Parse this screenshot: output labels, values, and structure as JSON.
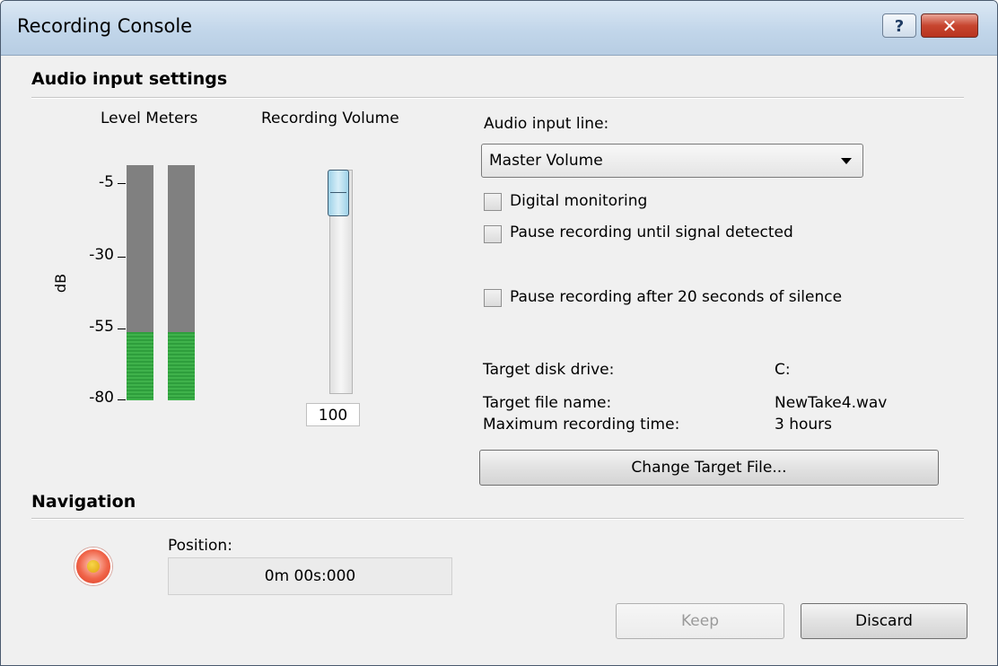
{
  "window": {
    "title": "Recording Console",
    "help_label": "?",
    "close_label": "✕"
  },
  "audio_section": {
    "heading": "Audio input settings"
  },
  "level_meters": {
    "label": "Level Meters",
    "axis_label": "dB",
    "scale": [
      "-5",
      "-30",
      "-55",
      "-80"
    ],
    "channels": [
      {
        "level_fraction": 0.29
      },
      {
        "level_fraction": 0.29
      }
    ],
    "colors": {
      "empty": "#808080",
      "fill": "#36a842"
    }
  },
  "recording_volume": {
    "label": "Recording Volume",
    "value": "100",
    "level_percent": 100
  },
  "audio_input": {
    "label": "Audio input line:",
    "selected": "Master Volume",
    "checkboxes": [
      {
        "label": "Digital monitoring",
        "checked": false
      },
      {
        "label": "Pause recording until signal detected",
        "checked": false
      },
      {
        "label": "Pause recording after 20 seconds of silence",
        "checked": false
      }
    ]
  },
  "target": {
    "disk_label": "Target disk drive:",
    "disk_value": "C:",
    "file_label": "Target file name:",
    "file_value": "NewTake4.wav",
    "time_label": "Maximum recording time:",
    "time_value": "3 hours",
    "change_button": "Change Target File..."
  },
  "navigation": {
    "heading": "Navigation",
    "position_label": "Position:",
    "position_value": "0m 00s:000"
  },
  "actions": {
    "keep": "Keep",
    "discard": "Discard"
  }
}
